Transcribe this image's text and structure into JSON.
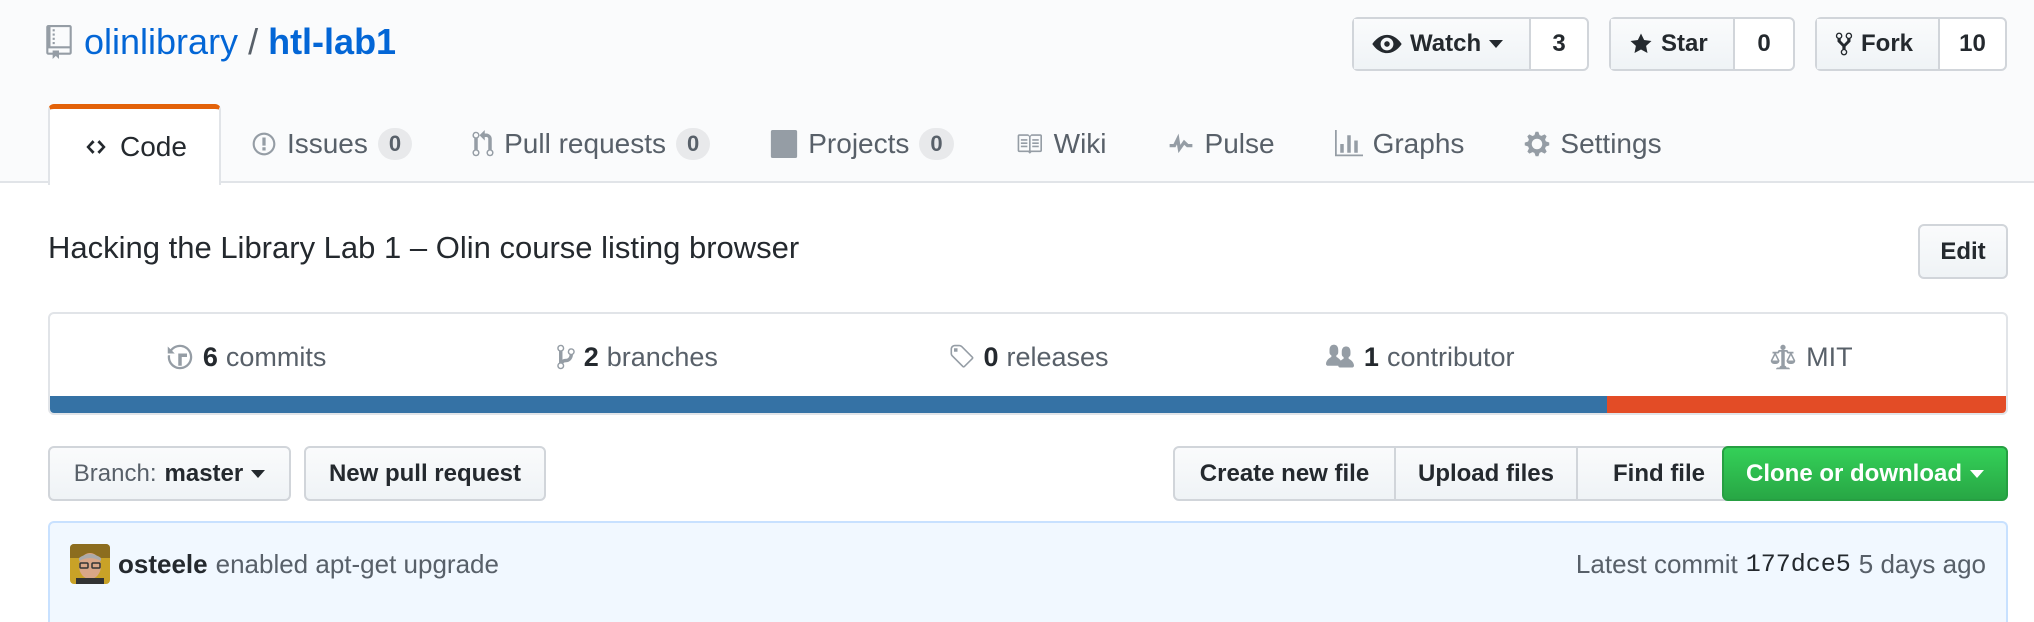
{
  "repo": {
    "owner": "olinlibrary",
    "separator": "/",
    "name": "htl-lab1",
    "description": "Hacking the Library Lab 1 – Olin course listing browser"
  },
  "actions": {
    "watch": {
      "label": "Watch",
      "count": "3"
    },
    "star": {
      "label": "Star",
      "count": "0"
    },
    "fork": {
      "label": "Fork",
      "count": "10"
    }
  },
  "tabs": [
    {
      "label": "Code",
      "icon": "code-icon"
    },
    {
      "label": "Issues",
      "count": "0",
      "icon": "issue-icon"
    },
    {
      "label": "Pull requests",
      "count": "0",
      "icon": "pull-request-icon"
    },
    {
      "label": "Projects",
      "count": "0",
      "icon": "project-icon"
    },
    {
      "label": "Wiki",
      "icon": "book-icon"
    },
    {
      "label": "Pulse",
      "icon": "pulse-icon"
    },
    {
      "label": "Graphs",
      "icon": "graph-icon"
    },
    {
      "label": "Settings",
      "icon": "gear-icon"
    }
  ],
  "edit_label": "Edit",
  "summary": {
    "commits": {
      "num": "6",
      "label": "commits"
    },
    "branches": {
      "num": "2",
      "label": "branches"
    },
    "releases": {
      "num": "0",
      "label": "releases"
    },
    "contributors": {
      "num": "1",
      "label": "contributor"
    },
    "license": "MIT"
  },
  "language_bar": [
    {
      "color": "#3572A5",
      "percent": 79.6
    },
    {
      "color": "#e34c26",
      "percent": 20.4
    }
  ],
  "file_nav": {
    "branch_prefix": "Branch:",
    "branch": "master",
    "new_pr": "New pull request",
    "create_file": "Create new file",
    "upload_files": "Upload files",
    "find_file": "Find file",
    "clone": "Clone or download"
  },
  "commit": {
    "author": "osteele",
    "message": "enabled apt-get upgrade",
    "latest_label": "Latest commit",
    "sha": "177dce5",
    "time": "5 days ago"
  },
  "colors": {
    "link": "#0366d6",
    "tab_accent": "#e36209",
    "clone_green": "#28a745"
  }
}
